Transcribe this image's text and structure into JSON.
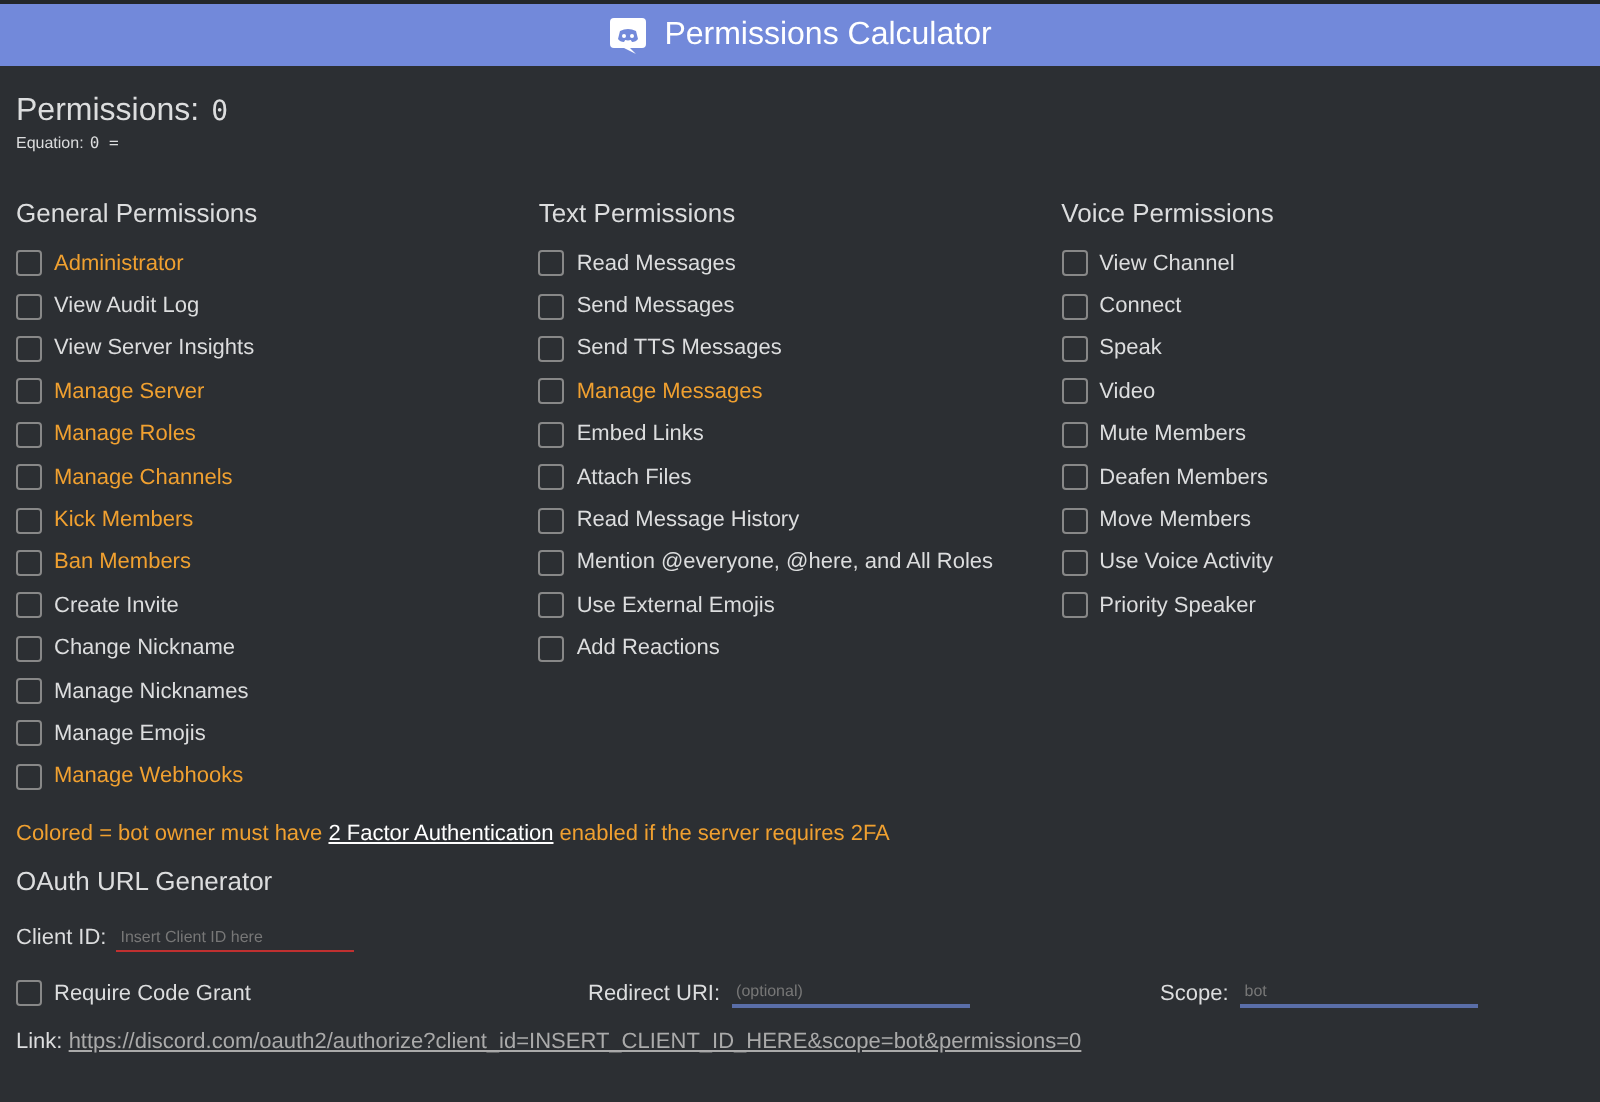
{
  "header": {
    "title": "Permissions Calculator"
  },
  "summary": {
    "label": "Permissions:",
    "value": "0",
    "equation_label": "Equation:",
    "equation": "0 ="
  },
  "groups": [
    {
      "title": "General Permissions",
      "items": [
        {
          "label": "Administrator",
          "twofa": true,
          "checked": false
        },
        {
          "label": "View Audit Log",
          "twofa": false,
          "checked": false
        },
        {
          "label": "View Server Insights",
          "twofa": false,
          "checked": false
        },
        {
          "label": "Manage Server",
          "twofa": true,
          "checked": false
        },
        {
          "label": "Manage Roles",
          "twofa": true,
          "checked": false
        },
        {
          "label": "Manage Channels",
          "twofa": true,
          "checked": false
        },
        {
          "label": "Kick Members",
          "twofa": true,
          "checked": false
        },
        {
          "label": "Ban Members",
          "twofa": true,
          "checked": false
        },
        {
          "label": "Create Invite",
          "twofa": false,
          "checked": false
        },
        {
          "label": "Change Nickname",
          "twofa": false,
          "checked": false
        },
        {
          "label": "Manage Nicknames",
          "twofa": false,
          "checked": false
        },
        {
          "label": "Manage Emojis",
          "twofa": false,
          "checked": false
        },
        {
          "label": "Manage Webhooks",
          "twofa": true,
          "checked": false
        }
      ]
    },
    {
      "title": "Text Permissions",
      "items": [
        {
          "label": "Read Messages",
          "twofa": false,
          "checked": false
        },
        {
          "label": "Send Messages",
          "twofa": false,
          "checked": false
        },
        {
          "label": "Send TTS Messages",
          "twofa": false,
          "checked": false
        },
        {
          "label": "Manage Messages",
          "twofa": true,
          "checked": false
        },
        {
          "label": "Embed Links",
          "twofa": false,
          "checked": false
        },
        {
          "label": "Attach Files",
          "twofa": false,
          "checked": false
        },
        {
          "label": "Read Message History",
          "twofa": false,
          "checked": false
        },
        {
          "label": "Mention @everyone, @here, and All Roles",
          "twofa": false,
          "checked": false
        },
        {
          "label": "Use External Emojis",
          "twofa": false,
          "checked": false
        },
        {
          "label": "Add Reactions",
          "twofa": false,
          "checked": false
        }
      ]
    },
    {
      "title": "Voice Permissions",
      "items": [
        {
          "label": "View Channel",
          "twofa": false,
          "checked": false
        },
        {
          "label": "Connect",
          "twofa": false,
          "checked": false
        },
        {
          "label": "Speak",
          "twofa": false,
          "checked": false
        },
        {
          "label": "Video",
          "twofa": false,
          "checked": false
        },
        {
          "label": "Mute Members",
          "twofa": false,
          "checked": false
        },
        {
          "label": "Deafen Members",
          "twofa": false,
          "checked": false
        },
        {
          "label": "Move Members",
          "twofa": false,
          "checked": false
        },
        {
          "label": "Use Voice Activity",
          "twofa": false,
          "checked": false
        },
        {
          "label": "Priority Speaker",
          "twofa": false,
          "checked": false
        }
      ]
    }
  ],
  "note": {
    "before": "Colored = bot owner must have",
    "link": "2 Factor Authentication",
    "after": "enabled if the server requires 2FA"
  },
  "oauth": {
    "title": "OAuth URL Generator",
    "client_id": {
      "label": "Client ID:",
      "placeholder": "Insert Client ID here"
    },
    "code_grant": {
      "label": "Require Code Grant",
      "checked": false
    },
    "redirect": {
      "label": "Redirect URI:",
      "placeholder": "(optional)"
    },
    "scope": {
      "label": "Scope:",
      "placeholder": "bot"
    },
    "link_label": "Link:",
    "link": "https://discord.com/oauth2/authorize?client_id=INSERT_CLIENT_ID_HERE&scope=bot&permissions=0"
  }
}
